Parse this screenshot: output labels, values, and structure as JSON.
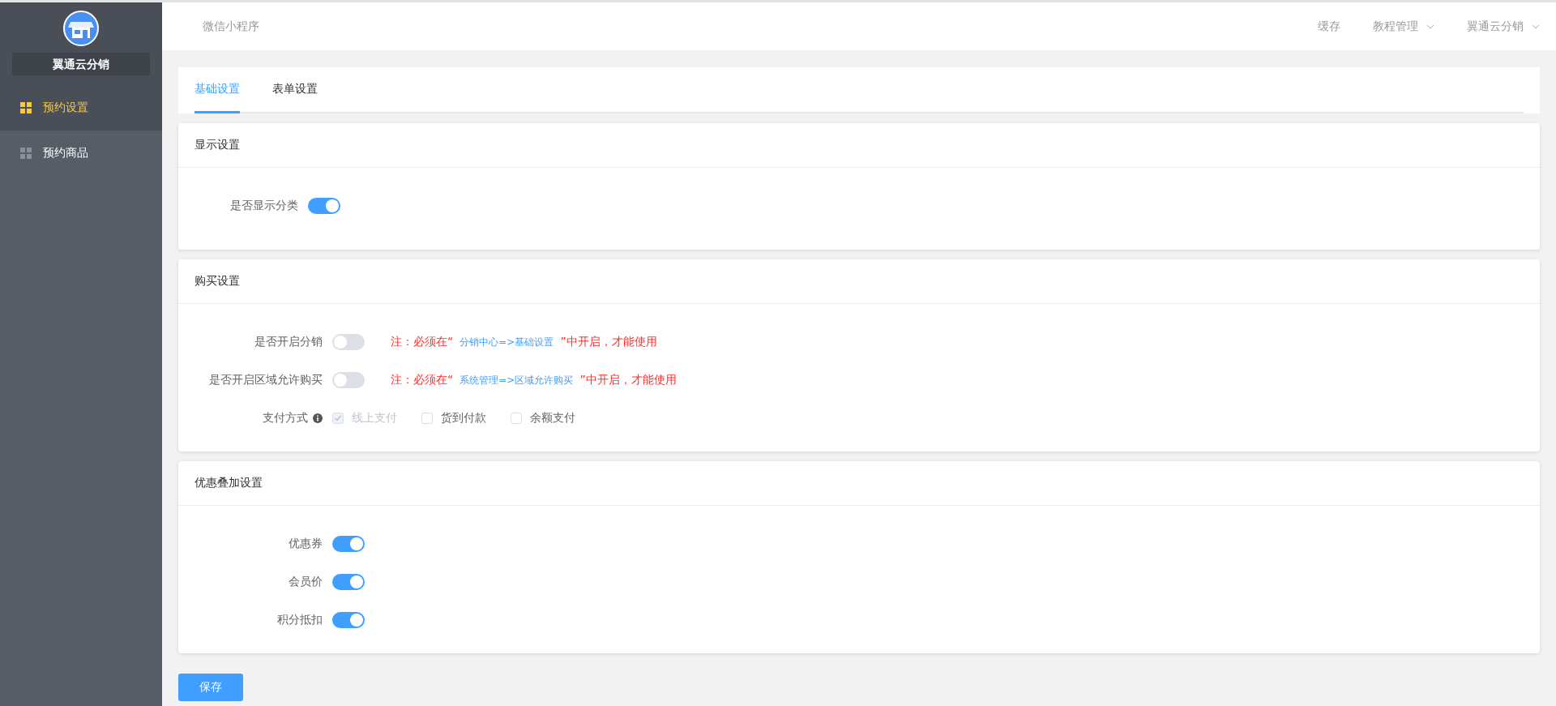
{
  "sidebar": {
    "brand": "翼通云分销",
    "items": [
      {
        "label": "预约设置",
        "selected": true
      },
      {
        "label": "预约商品",
        "selected": false
      }
    ]
  },
  "header": {
    "title": "微信小程序",
    "links": [
      {
        "label": "缓存",
        "dropdown": false
      },
      {
        "label": "教程管理",
        "dropdown": true
      },
      {
        "label": "翼通云分销",
        "dropdown": true
      }
    ]
  },
  "tabs": [
    {
      "label": "基础设置",
      "selected": true
    },
    {
      "label": "表单设置",
      "selected": false
    }
  ],
  "sections": [
    {
      "title": "显示设置",
      "rows": [
        {
          "kind": "toggle",
          "label": "是否显示分类",
          "on": true
        }
      ]
    },
    {
      "title": "购买设置",
      "rows": [
        {
          "kind": "toggle",
          "label": "是否开启分销",
          "on": false,
          "note": {
            "prefix": "注：必须在“",
            "link": "分销中心=>基础设置",
            "suffix": "”中开启，才能使用"
          }
        },
        {
          "kind": "toggle",
          "label": "是否开启区域允许购买",
          "on": false,
          "note": {
            "prefix": "注：必须在“",
            "link": "系统管理=>区域允许购买",
            "suffix": "”中开启，才能使用"
          }
        },
        {
          "kind": "checkboxes",
          "label": "支付方式",
          "options": [
            {
              "label": "线上支付",
              "checked": true,
              "disabled": true
            },
            {
              "label": "货到付款",
              "checked": false,
              "disabled": false
            },
            {
              "label": "余额支付",
              "checked": false,
              "disabled": false
            }
          ]
        }
      ]
    },
    {
      "title": "优惠叠加设置",
      "rows": [
        {
          "kind": "toggle",
          "label": "优惠券",
          "on": true
        },
        {
          "kind": "toggle",
          "label": "会员价",
          "on": true
        },
        {
          "kind": "toggle",
          "label": "积分抵扣",
          "on": true
        }
      ]
    }
  ],
  "save_button": "保存"
}
